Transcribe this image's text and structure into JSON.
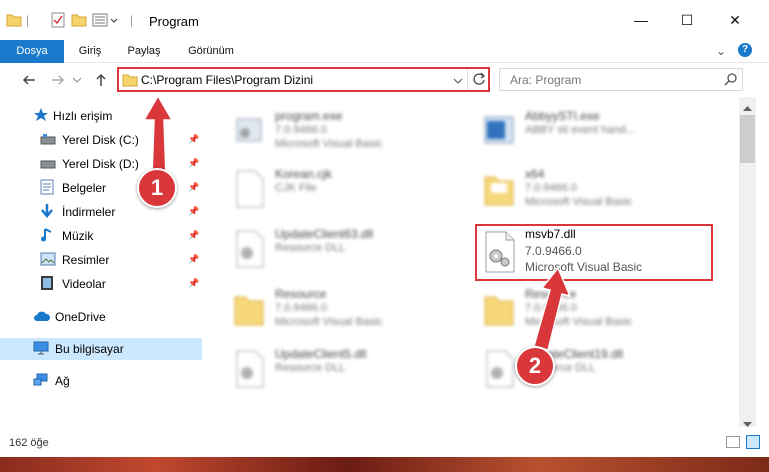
{
  "window": {
    "title": "Program",
    "controls": {
      "minimize": "—",
      "maximize": "☐",
      "close": "✕"
    }
  },
  "ribbon": {
    "tabs": [
      "Dosya",
      "Giriş",
      "Paylaş",
      "Görünüm"
    ],
    "active_tab": "Dosya"
  },
  "nav": {
    "address": "C:\\Program Files\\Program Dizini",
    "search_placeholder": "Ara: Program"
  },
  "sidebar": {
    "items": [
      {
        "label": "Hızlı erişim",
        "icon": "star-icon"
      },
      {
        "label": "Yerel Disk (C:)",
        "icon": "drive-icon",
        "pinned": true
      },
      {
        "label": "Yerel Disk (D:)",
        "icon": "drive-icon",
        "pinned": true
      },
      {
        "label": "Belgeler",
        "icon": "documents-icon",
        "pinned": true
      },
      {
        "label": "İndirmeler",
        "icon": "download-icon",
        "pinned": true
      },
      {
        "label": "Müzik",
        "icon": "music-icon",
        "pinned": true
      },
      {
        "label": "Resimler",
        "icon": "pictures-icon",
        "pinned": true
      },
      {
        "label": "Videolar",
        "icon": "videos-icon",
        "pinned": true
      },
      {
        "label": "OneDrive",
        "icon": "cloud-icon"
      },
      {
        "label": "Bu bilgisayar",
        "icon": "computer-icon",
        "selected": true
      },
      {
        "label": "Ağ",
        "icon": "network-icon"
      }
    ]
  },
  "files": [
    {
      "name": "program.exe",
      "line1": "7.0.9466.0",
      "line2": "Microsoft Visual Basic",
      "kind": "exe"
    },
    {
      "name": "AbbyySTI.exe",
      "line1": "ABBY sti event hand...",
      "line2": "",
      "kind": "exe-blue"
    },
    {
      "name": "Korean.cjk",
      "line1": "CJK File",
      "line2": "",
      "kind": "doc"
    },
    {
      "name": "x64",
      "line1": "7.0.9466.0",
      "line2": "Microsoft Visual Basic",
      "kind": "folder"
    },
    {
      "name": "UpdateClient63.dll",
      "line1": "Resource DLL",
      "line2": "",
      "kind": "dll"
    },
    {
      "name": "msvb7.dll",
      "line1": "7.0.9466.0",
      "line2": "Microsoft Visual Basic",
      "kind": "dll",
      "highlighted": true
    },
    {
      "name": "Resource",
      "line1": "7.0.9466.0",
      "line2": "Microsoft Visual Basic",
      "kind": "folder"
    },
    {
      "name": "Resource",
      "line1": "7.0.9466.0",
      "line2": "Microsoft Visual Basic",
      "kind": "folder"
    },
    {
      "name": "UpdateClient5.dll",
      "line1": "Resource DLL",
      "line2": "",
      "kind": "dll"
    },
    {
      "name": "UpdateClient19.dll",
      "line1": "Resource DLL",
      "line2": "",
      "kind": "dll"
    }
  ],
  "status": {
    "count": "162 öğe"
  },
  "callouts": [
    "1",
    "2"
  ],
  "colors": {
    "accent": "#1979ca",
    "highlight": "#d9373a",
    "selected": "#cce8ff"
  }
}
